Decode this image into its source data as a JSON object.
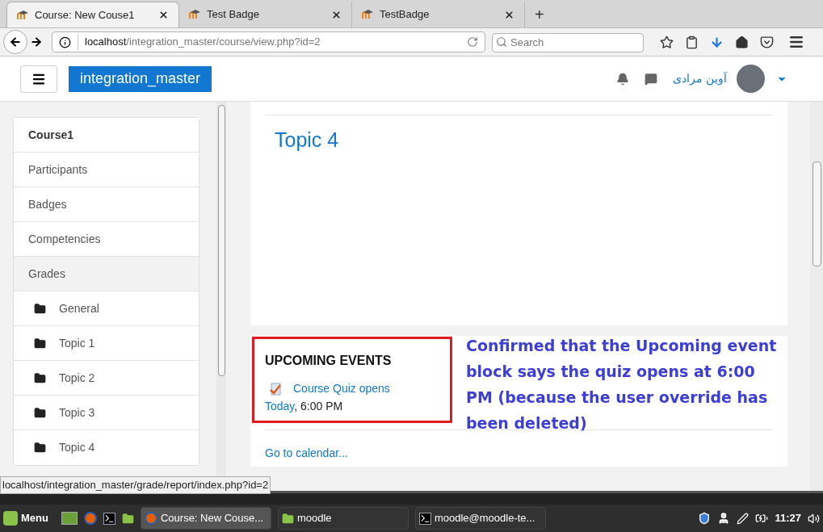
{
  "browser": {
    "tabs": [
      {
        "title": "Course: New Couse1",
        "selected": true
      },
      {
        "title": "Test Badge",
        "selected": false
      },
      {
        "title": "TestBadge",
        "selected": false
      }
    ],
    "new_tab": "+",
    "url": {
      "host": "localhost",
      "path": "/integration_master/course/view.php?id=2"
    },
    "search": {
      "placeholder": "Search"
    }
  },
  "site": {
    "brand": "integration_master",
    "user_name": "آوین مرادی"
  },
  "sidebar": {
    "items": [
      {
        "label": "Course1",
        "kind": "course",
        "selected": false
      },
      {
        "label": "Participants",
        "kind": "link",
        "selected": false
      },
      {
        "label": "Badges",
        "kind": "link",
        "selected": false
      },
      {
        "label": "Competencies",
        "kind": "link",
        "selected": false
      },
      {
        "label": "Grades",
        "kind": "link",
        "selected": true
      },
      {
        "label": "General",
        "kind": "folder",
        "selected": false
      },
      {
        "label": "Topic 1",
        "kind": "folder",
        "selected": false
      },
      {
        "label": "Topic 2",
        "kind": "folder",
        "selected": false
      },
      {
        "label": "Topic 3",
        "kind": "folder",
        "selected": false
      },
      {
        "label": "Topic 4",
        "kind": "folder",
        "selected": false
      }
    ]
  },
  "main": {
    "section_title": "Topic 4",
    "upcoming_events": {
      "title": "UPCOMING EVENTS",
      "event": "Course Quiz opens",
      "date": "Today",
      "time": ", 6:00 PM",
      "calendar_link": "Go to calendar..."
    },
    "annotation": "Confirmed that the Upcoming event block says the quiz opens at 6:00 PM (because the user override has been deleted)"
  },
  "status_url": "localhost/integration_master/grade/report/index.php?id=2",
  "taskbar": {
    "menu": "Menu",
    "windows": [
      {
        "label": "Course: New Couse...",
        "kind": "browser",
        "selected": true
      },
      {
        "label": "moodle",
        "kind": "folder",
        "selected": false
      },
      {
        "label": "moodle@moodle-te...",
        "kind": "terminal",
        "selected": false
      }
    ],
    "clock": "11:27"
  }
}
